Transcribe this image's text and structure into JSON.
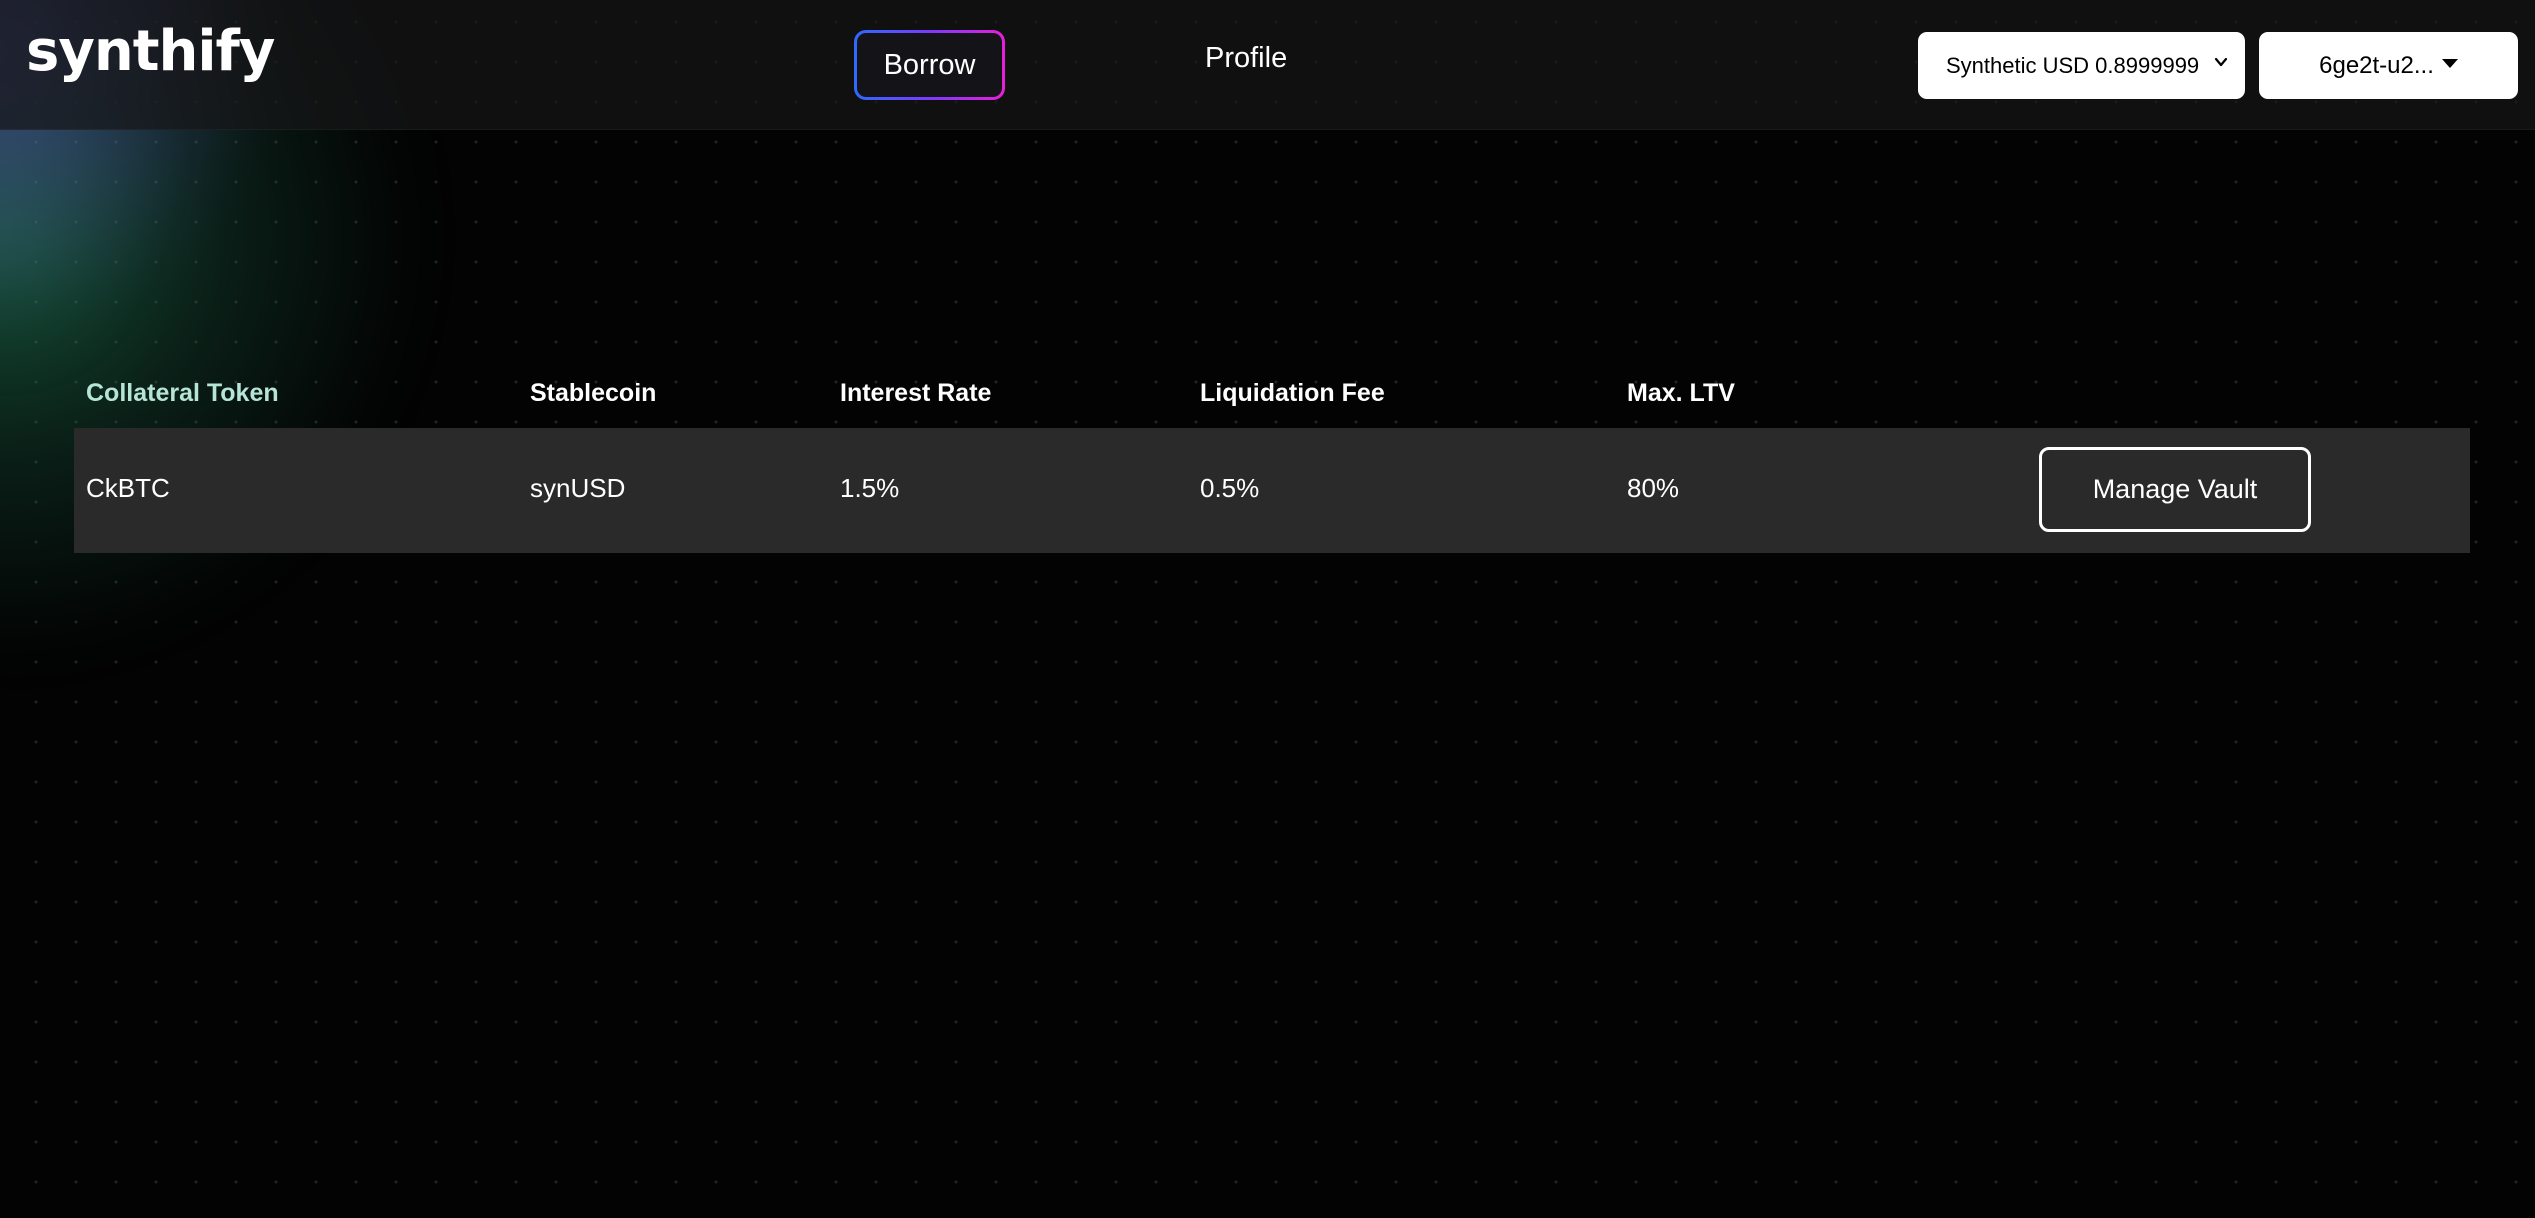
{
  "brand": {
    "logo_text": "synthify"
  },
  "nav": {
    "borrow_label": "Borrow",
    "profile_label": "Profile"
  },
  "token_select": {
    "selected": "Synthetic USD 0.8999999"
  },
  "wallet": {
    "label": "6ge2t-u2..."
  },
  "table": {
    "columns": [
      "Collateral Token",
      "Stablecoin",
      "Interest Rate",
      "Liquidation Fee",
      "Max. LTV"
    ],
    "rows": [
      {
        "collateral": "CkBTC",
        "stablecoin": "synUSD",
        "interest_rate": "1.5%",
        "liquidation_fee": "0.5%",
        "max_ltv": "80%",
        "action_label": "Manage Vault"
      }
    ]
  },
  "colors": {
    "background": "#030303",
    "header": "#161618",
    "row": "#2a2a2a",
    "accent_blue": "#2c6bff",
    "accent_magenta": "#e81fd8",
    "first_header": "#b6e4d6"
  }
}
